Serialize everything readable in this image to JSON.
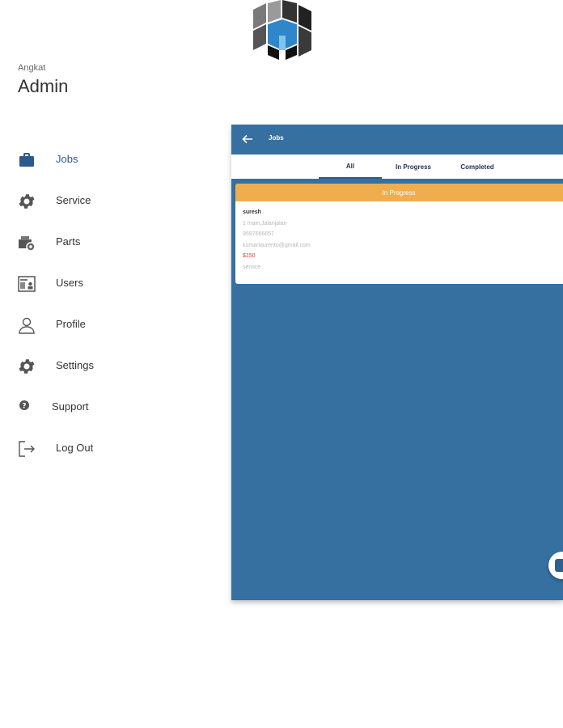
{
  "brand": {
    "org": "Angkat",
    "role": "Admin",
    "logo_icon": "cube-logo-icon"
  },
  "menu": [
    {
      "label": "Jobs",
      "icon": "briefcase-icon",
      "active": true
    },
    {
      "label": "Service",
      "icon": "gear-icon"
    },
    {
      "label": "Parts",
      "icon": "parts-icon"
    },
    {
      "label": "Users",
      "icon": "users-icon"
    },
    {
      "label": "Profile",
      "icon": "person-icon"
    },
    {
      "label": "Settings",
      "icon": "gear-icon"
    },
    {
      "label": "Support",
      "icon": "help-icon"
    },
    {
      "label": "Log Out",
      "icon": "logout-icon"
    }
  ],
  "app": {
    "title": "Jobs",
    "tabs": [
      {
        "label": "All",
        "active": true
      },
      {
        "label": "In Progress"
      },
      {
        "label": "Completed"
      }
    ],
    "job_card": {
      "status": "In Progress",
      "name": "suresh",
      "address": "1 main,Jalanjalan",
      "phone": "9597666657",
      "email": "kumarlaurento@gmail.com",
      "price": "$150",
      "type": "service"
    }
  },
  "colors": {
    "primary": "#3670a0",
    "status_in_progress": "#f0ad4e",
    "price": "#e53935",
    "active_menu": "#2d5a8e"
  }
}
